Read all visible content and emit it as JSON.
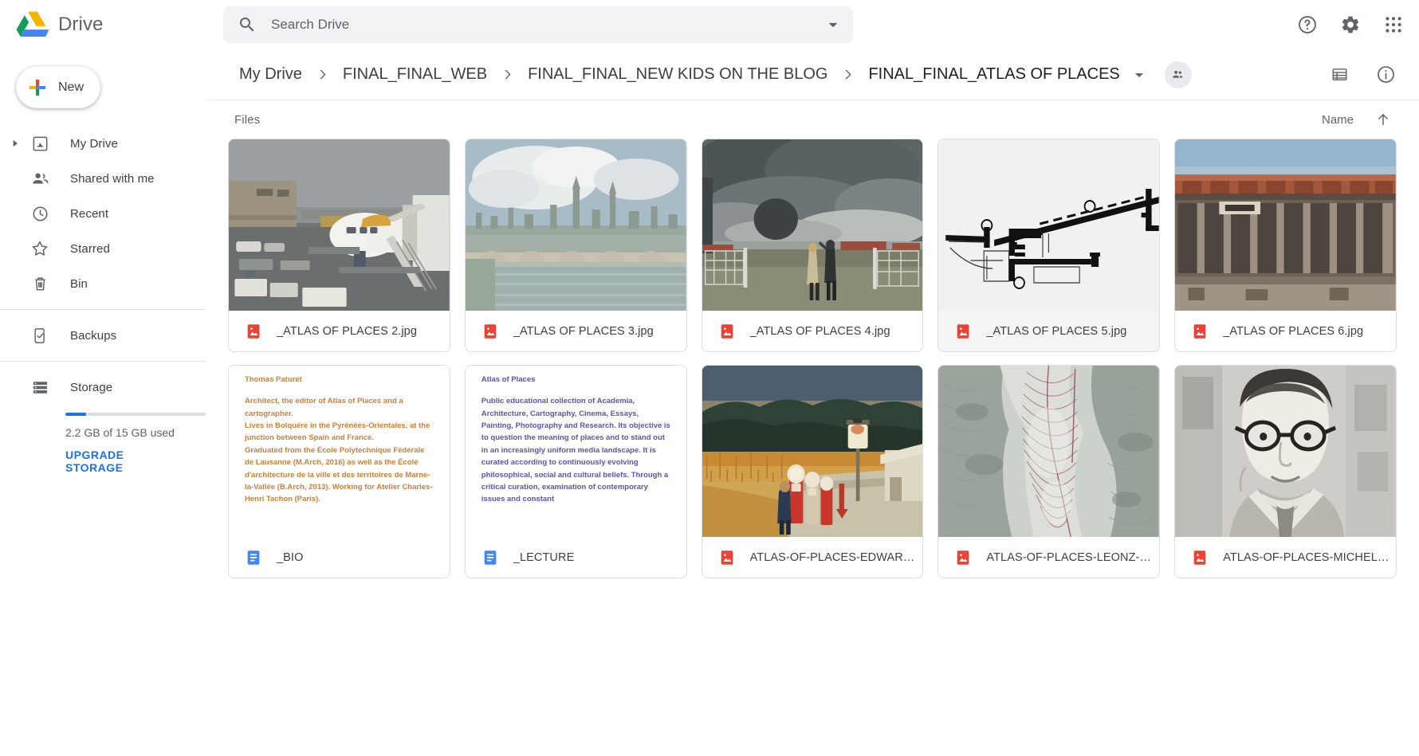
{
  "app": {
    "brand_name": "Drive",
    "logo_icon": "google-drive-logo"
  },
  "search": {
    "placeholder": "Search Drive",
    "value": "",
    "icon": "search-icon",
    "options_icon": "chevron-down-icon"
  },
  "header_actions": [
    {
      "name": "help-button",
      "icon": "help-circle-icon"
    },
    {
      "name": "settings-button",
      "icon": "gear-icon"
    },
    {
      "name": "apps-button",
      "icon": "apps-grid-icon"
    }
  ],
  "sidebar": {
    "new_button": {
      "label": "New",
      "icon": "plus-icon"
    },
    "items": [
      {
        "label": "My Drive",
        "icon": "my-drive-icon",
        "expander": true
      },
      {
        "label": "Shared with me",
        "icon": "shared-with-me-icon",
        "expander": false
      },
      {
        "label": "Recent",
        "icon": "clock-icon",
        "expander": false
      },
      {
        "label": "Starred",
        "icon": "star-icon",
        "expander": false
      },
      {
        "label": "Bin",
        "icon": "trash-icon",
        "expander": false
      }
    ],
    "backups": {
      "label": "Backups",
      "icon": "backup-phone-icon"
    },
    "storage": {
      "label": "Storage",
      "icon": "storage-icon",
      "used_text": "2.2 GB of 15 GB used",
      "upgrade_label": "UPGRADE STORAGE",
      "percent_used": 15,
      "bar_color": "#1a73e8"
    }
  },
  "breadcrumb": {
    "items": [
      "My Drive",
      "FINAL_FINAL_WEB",
      "FINAL_FINAL_NEW KIDS ON THE BLOG",
      "FINAL_FINAL_ATLAS OF PLACES"
    ],
    "separator": "chevron-right-icon",
    "dropdown_icon": "caret-down-icon",
    "share_icon": "people-icon",
    "list_view_icon": "list-view-icon",
    "details_icon": "info-circle-icon"
  },
  "sort": {
    "section_label": "Files",
    "field_label": "Name",
    "direction_icon": "arrow-up-icon"
  },
  "files": [
    {
      "name": "_ATLAS OF PLACES 2.jpg",
      "type": "image",
      "type_icon": "image-file-icon",
      "selected": false,
      "thumb": "airport-plane-jetway-photo"
    },
    {
      "name": "_ATLAS OF PLACES 3.jpg",
      "type": "image",
      "type_icon": "image-file-icon",
      "selected": false,
      "thumb": "city-river-bridge-painting"
    },
    {
      "name": "_ATLAS OF PLACES 4.jpg",
      "type": "image",
      "type_icon": "image-file-icon",
      "selected": false,
      "thumb": "storm-smoke-figures-photo"
    },
    {
      "name": "_ATLAS OF PLACES 5.jpg",
      "type": "image",
      "type_icon": "image-file-icon",
      "selected": true,
      "thumb": "architectural-plan-drawing"
    },
    {
      "name": "_ATLAS OF PLACES 6.jpg",
      "type": "image",
      "type_icon": "image-file-icon",
      "selected": false,
      "thumb": "brick-building-facade-photo"
    },
    {
      "name": "_BIO",
      "type": "document",
      "type_icon": "google-doc-icon",
      "selected": false,
      "thumb": "doc-text-preview",
      "doc": {
        "color": "#c8813a",
        "title": "Thomas Paturet",
        "body": "Architect, the editor of Atlas of Places and a cartographer.\nLives in Bolquère in the Pyrénées-Orientales, at the junction between Spain and France.\nGraduated from the École Polytechnique Fédérale de Lausanne (M.Arch, 2016) as well as the École d'architecture de la ville et des territoires de Marne-la-Vallée (B.Arch, 2013). Working for Atelier Charles-Henri Tachon (Paris)."
      }
    },
    {
      "name": "_LECTURE",
      "type": "document",
      "type_icon": "google-doc-icon",
      "selected": false,
      "thumb": "doc-text-preview",
      "doc": {
        "color": "#5b55a8",
        "title": "Atlas of Places",
        "body": "Public educational collection of Academia, Architecture, Cartography, Cinema, Essays, Painting, Photography and Research. Its objective is to question the meaning of places and to stand out in an increasingly uniform media landscape. It is curated according to continuously evolving philosophical, social and cultural beliefs. Through a critical curation, examination of contemporary issues and constant"
      }
    },
    {
      "name": "ATLAS-OF-PLACES-EDWAR…",
      "type": "image",
      "type_icon": "image-file-icon",
      "selected": false,
      "thumb": "hopper-gas-station-painting"
    },
    {
      "name": "ATLAS-OF-PLACES-LEONZ-…",
      "type": "image",
      "type_icon": "image-file-icon",
      "selected": false,
      "thumb": "topographic-relief-map"
    },
    {
      "name": "ATLAS-OF-PLACES-MICHEL…",
      "type": "image",
      "type_icon": "image-file-icon",
      "selected": false,
      "thumb": "portrait-man-glasses-bw-photo"
    }
  ],
  "colors": {
    "accent_blue": "#1a73e8",
    "image_file_red": "#ea4335",
    "doc_blue": "#4285f4",
    "text_primary": "#3c4043",
    "text_secondary": "#5f6368",
    "border": "#dadce0"
  }
}
